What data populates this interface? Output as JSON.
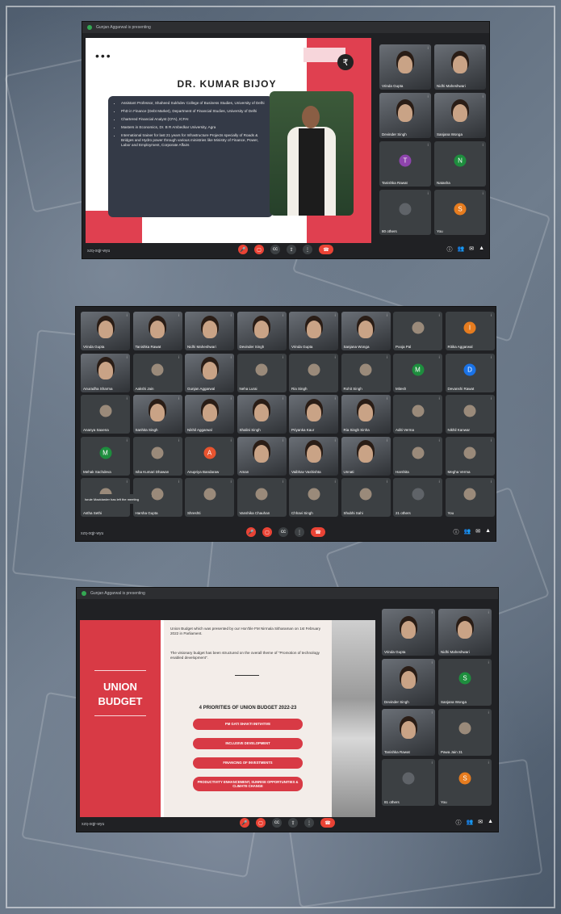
{
  "window1": {
    "presenting": "Gunjan Aggarwal is presenting",
    "code": "xzq-oqjr-wyu",
    "slide": {
      "title": "DR. KUMAR BIJOY",
      "bullets": [
        "Assistant Professor, Shaheed Sukhdev College of Business Studies, University of Delhi",
        "PhD in Finance (Debt Market), Department of Financial Studies, University of Delhi",
        "Chartered Financial Analyst (CFA), ICFAI",
        "Masters in Economics, Dr. B R Ambedkar University, Agra",
        "International trainer for last 21 years for Infrastructure Projects specially of Roads & Bridges and Hydro power through various ministries like Ministry of Finance, Power, Labor and Employment, Corporate Affairs"
      ]
    },
    "tiles": [
      {
        "name": "Vrinda Gupta",
        "type": "video"
      },
      {
        "name": "Nidhi Maheshwari",
        "type": "video"
      },
      {
        "name": "Devinder Singh",
        "type": "video"
      },
      {
        "name": "Sanjana Wonga",
        "type": "video"
      },
      {
        "name": "Tanishka Rawat",
        "type": "avatar",
        "letter": "T",
        "color": "#8e44ad"
      },
      {
        "name": "Natasha",
        "type": "avatar",
        "letter": "N",
        "color": "#1e8e3e"
      },
      {
        "name": "80 others",
        "type": "others"
      },
      {
        "name": "You",
        "type": "avatar",
        "letter": "S",
        "color": "#e67c1f"
      }
    ]
  },
  "window2": {
    "code": "xzq-oqjr-wyu",
    "toast": "Isrule Mazidarder has left the meeting",
    "tiles": [
      {
        "name": "Vrinda Gupta",
        "type": "video"
      },
      {
        "name": "Tanishka Rawat",
        "type": "video"
      },
      {
        "name": "Nidhi Maheshwari",
        "type": "video"
      },
      {
        "name": "Devinder Singh",
        "type": "video"
      },
      {
        "name": "Vrinda Gupta",
        "type": "video"
      },
      {
        "name": "Sanjana Wonga",
        "type": "video"
      },
      {
        "name": "Pooja Pal",
        "type": "photo"
      },
      {
        "name": "Ritika Aggarwal",
        "type": "avatar",
        "letter": "I",
        "color": "#e67c1f"
      },
      {
        "name": "Anuradha Sharma",
        "type": "video"
      },
      {
        "name": "Aakshi Jain",
        "type": "photo"
      },
      {
        "name": "Gunjan Aggarwal",
        "type": "video"
      },
      {
        "name": "Neha Lurai",
        "type": "photo"
      },
      {
        "name": "Ria Singh",
        "type": "photo"
      },
      {
        "name": "Rohit Singh",
        "type": "photo"
      },
      {
        "name": "Mitesh",
        "type": "avatar",
        "letter": "M",
        "color": "#1e8e3e"
      },
      {
        "name": "Devanshi Rawat",
        "type": "avatar",
        "letter": "D",
        "color": "#1a73e8"
      },
      {
        "name": "Ananya Saxena",
        "type": "photo"
      },
      {
        "name": "Sanhita Singh",
        "type": "video"
      },
      {
        "name": "Nikhil Aggarwal",
        "type": "video"
      },
      {
        "name": "Shalini Singh",
        "type": "video"
      },
      {
        "name": "Priyanka Kaur",
        "type": "video"
      },
      {
        "name": "Ria Singh Sinha",
        "type": "video"
      },
      {
        "name": "Aditi Verma",
        "type": "photo"
      },
      {
        "name": "Nikhil Kanwar",
        "type": "photo"
      },
      {
        "name": "Mehak Sachdeva",
        "type": "avatar",
        "letter": "M",
        "color": "#1e8e3e"
      },
      {
        "name": "Isha Kumari Dhawan",
        "type": "photo"
      },
      {
        "name": "Anupriya Bandaraw",
        "type": "avatar",
        "letter": "A",
        "color": "#e8542f"
      },
      {
        "name": "Aman",
        "type": "video"
      },
      {
        "name": "Vaibhav Vashishta",
        "type": "video"
      },
      {
        "name": "Unnati",
        "type": "video"
      },
      {
        "name": "Harshita",
        "type": "photo"
      },
      {
        "name": "Megha Verma",
        "type": "photo"
      },
      {
        "name": "Astha Sethi",
        "type": "photo"
      },
      {
        "name": "Harsha Gupta",
        "type": "photo"
      },
      {
        "name": "Shreshti",
        "type": "photo"
      },
      {
        "name": "Vanshika Chauhan",
        "type": "photo"
      },
      {
        "name": "Chhavi Singh",
        "type": "photo"
      },
      {
        "name": "Shubhi Sahi",
        "type": "photo"
      },
      {
        "name": "21 others",
        "type": "others"
      },
      {
        "name": "You",
        "type": "photo"
      }
    ]
  },
  "window3": {
    "presenting": "Gunjan Aggarwal is presenting",
    "code": "xzq-oqjr-wyu",
    "slide": {
      "title_line1": "UNION",
      "title_line2": "BUDGET",
      "para1": "Union Budget which was presented by our Hon'ble FM Nirmala Sitharaman on 1st February 2022 in Parliament.",
      "para2": "The visionary budget has been structured on the overall theme of \"Promotion of technology enabled development\".",
      "heading": "4 PRIORITIES OF UNION BUDGET 2022-23",
      "pills": [
        "PM GATI SHAKTI INITIATIVE",
        "INCLUSIVE DEVELOPMENT",
        "FINANCING OF INVESTMENTS",
        "PRODUCTIVITY ENHANCEMENT, SUNRISE OPPORTUNITIES & CLIMATE CHANGE"
      ]
    },
    "tiles": [
      {
        "name": "Vrinda Gupta",
        "type": "video"
      },
      {
        "name": "Nidhi Maheshwari",
        "type": "video"
      },
      {
        "name": "Devinder Singh",
        "type": "video"
      },
      {
        "name": "Sanjana Wonga",
        "type": "avatar",
        "letter": "S",
        "color": "#1e8e3e"
      },
      {
        "name": "Tanishka Rawat",
        "type": "video"
      },
      {
        "name": "Pawa Jain 31",
        "type": "photo"
      },
      {
        "name": "81 others",
        "type": "others"
      },
      {
        "name": "You",
        "type": "avatar",
        "letter": "S",
        "color": "#e67c1f"
      }
    ]
  },
  "colors": {
    "meet_bg": "#202124",
    "tile_bg": "#3c4043",
    "accent_red": "#ea4335",
    "slide_red": "#d83a45"
  }
}
